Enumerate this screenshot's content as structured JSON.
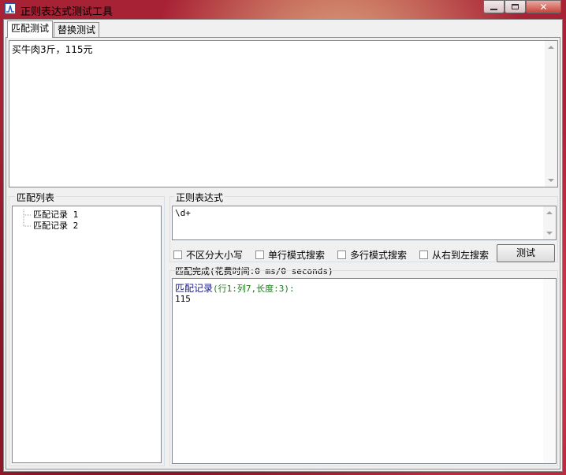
{
  "window": {
    "title": "正则表达式测试工具",
    "controls": [
      "minimize-icon",
      "maximize-icon",
      "close-icon"
    ]
  },
  "tabs": [
    {
      "label": "匹配测试",
      "active": true
    },
    {
      "label": "替换测试",
      "active": false
    }
  ],
  "input": {
    "text": "买牛肉3斤，115元"
  },
  "match_list": {
    "group_label": "匹配列表",
    "items": [
      "匹配记录 1",
      "匹配记录 2"
    ]
  },
  "regex": {
    "group_label": "正则表达式",
    "value": "\\d+"
  },
  "options": {
    "ignore_case": "不区分大小写",
    "single_line": "单行模式搜索",
    "multi_line": "多行模式搜索",
    "right_to_left": "从右到左搜索",
    "test_button": "测试"
  },
  "status": {
    "text": "匹配完成(花费时间:0 ms/0 seconds)"
  },
  "result": {
    "label": "匹配记录",
    "detail": "(行1:列7,长度:3):",
    "value": "115"
  }
}
